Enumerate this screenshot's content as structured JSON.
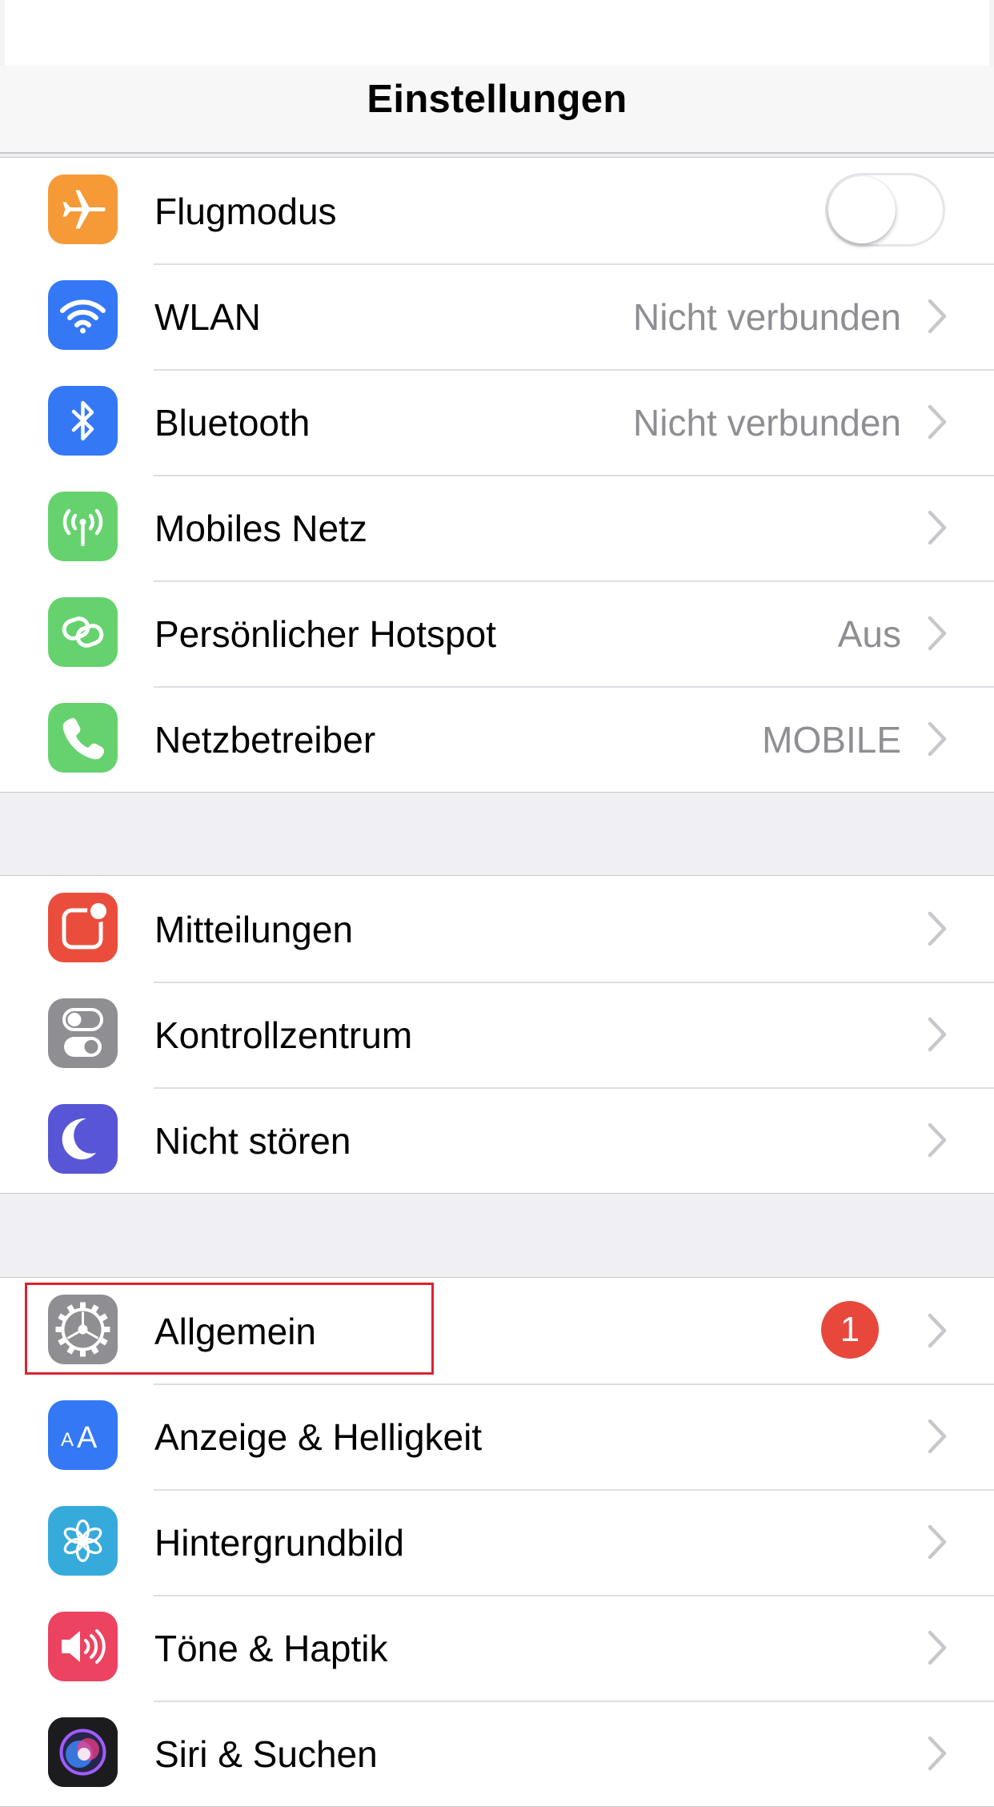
{
  "nav": {
    "title": "Einstellungen"
  },
  "groups": [
    {
      "rows": [
        {
          "label": "Flugmodus",
          "icon": "airplane-icon",
          "color": "#f59a36",
          "control": "toggle",
          "toggle_on": false
        },
        {
          "label": "WLAN",
          "value": "Nicht verbunden",
          "icon": "wifi-icon",
          "color": "#3478f6"
        },
        {
          "label": "Bluetooth",
          "value": "Nicht verbunden",
          "icon": "bluetooth-icon",
          "color": "#3478f6"
        },
        {
          "label": "Mobiles Netz",
          "icon": "antenna-icon",
          "color": "#65d26e"
        },
        {
          "label": "Persönlicher Hotspot",
          "value": "Aus",
          "icon": "hotspot-icon",
          "color": "#65d26e"
        },
        {
          "label": "Netzbetreiber",
          "value": "MOBILE",
          "icon": "phone-icon",
          "color": "#65d26e"
        }
      ]
    },
    {
      "rows": [
        {
          "label": "Mitteilungen",
          "icon": "notifications-icon",
          "color": "#eb4d3d"
        },
        {
          "label": "Kontrollzentrum",
          "icon": "control-center-icon",
          "color": "#8e8e93"
        },
        {
          "label": "Nicht stören",
          "icon": "moon-icon",
          "color": "#5856d6"
        }
      ]
    },
    {
      "rows": [
        {
          "label": "Allgemein",
          "badge": "1",
          "icon": "gear-icon",
          "color": "#8e8e93",
          "highlighted": true
        },
        {
          "label": "Anzeige & Helligkeit",
          "icon": "text-size-icon",
          "color": "#3478f6"
        },
        {
          "label": "Hintergrundbild",
          "icon": "wallpaper-icon",
          "color": "#37aadc"
        },
        {
          "label": "Töne & Haptik",
          "icon": "speaker-icon",
          "color": "#eb4360"
        },
        {
          "label": "Siri & Suchen",
          "icon": "siri-icon",
          "color": "#1c1c1e"
        }
      ]
    }
  ],
  "colors": {
    "highlight_box": "#d9242f",
    "badge": "#e8473b",
    "secondary_text": "#8e8e93",
    "chevron": "#c7c7cc"
  }
}
